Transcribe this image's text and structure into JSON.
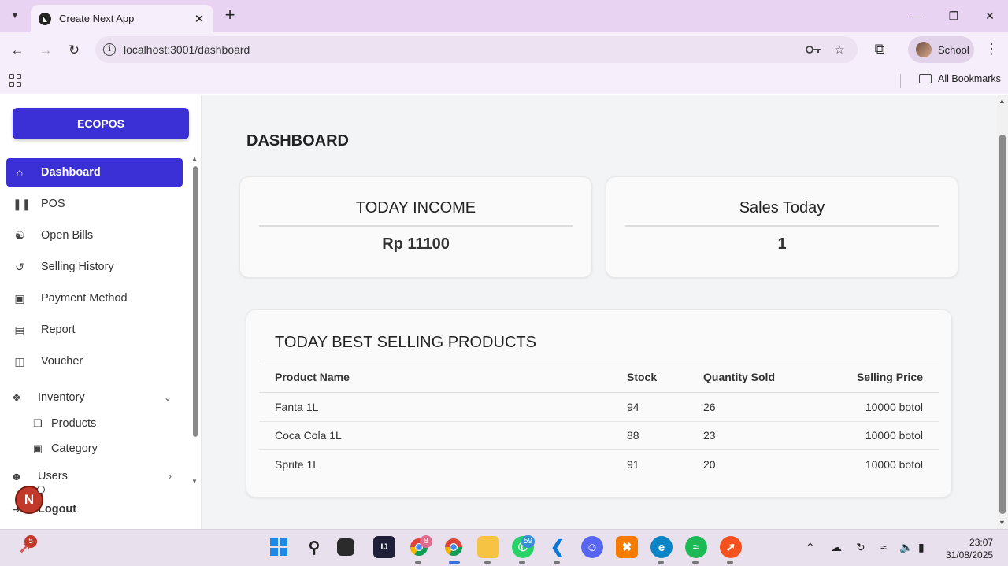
{
  "browser": {
    "tab_title": "Create Next App",
    "url": "localhost:3001/dashboard",
    "profile_name": "School",
    "bookmarks_label": "All Bookmarks"
  },
  "sidebar": {
    "brand": "ECOPOS",
    "items": [
      {
        "label": "Dashboard",
        "icon": "home-icon"
      },
      {
        "label": "POS",
        "icon": "barcode-icon"
      },
      {
        "label": "Open Bills",
        "icon": "bills-icon"
      },
      {
        "label": "Selling History",
        "icon": "history-icon"
      },
      {
        "label": "Payment Method",
        "icon": "wallet-icon"
      },
      {
        "label": "Report",
        "icon": "report-icon"
      },
      {
        "label": "Voucher",
        "icon": "ticket-icon"
      },
      {
        "label": "Inventory",
        "icon": "boxes-icon"
      },
      {
        "label": "Users",
        "icon": "user-icon"
      },
      {
        "label": "Logout",
        "icon": "logout-icon"
      }
    ],
    "inventory_sub": [
      {
        "label": "Products",
        "icon": "box-icon"
      },
      {
        "label": "Category",
        "icon": "category-icon"
      }
    ]
  },
  "main": {
    "page_title": "DASHBOARD",
    "income_title": "TODAY INCOME",
    "income_value": "Rp 11100",
    "sales_title": "Sales Today",
    "sales_value": "1",
    "table_title": "TODAY BEST SELLING PRODUCTS",
    "columns": [
      "Product Name",
      "Stock",
      "Quantity Sold",
      "Selling Price"
    ],
    "rows": [
      [
        "Fanta 1L",
        "94",
        "26",
        "10000 botol"
      ],
      [
        "Coca Cola 1L",
        "88",
        "23",
        "10000 botol"
      ],
      [
        "Sprite 1L",
        "91",
        "20",
        "10000 botol"
      ]
    ]
  },
  "next_badge": "N",
  "taskbar": {
    "notify_count": "5",
    "chrome_badge": "8",
    "whatsapp_badge": "59",
    "time": "23:07",
    "date": "31/08/2025"
  },
  "colors": {
    "brand": "#3b30d6",
    "tab_strip": "#e9d3f3"
  }
}
